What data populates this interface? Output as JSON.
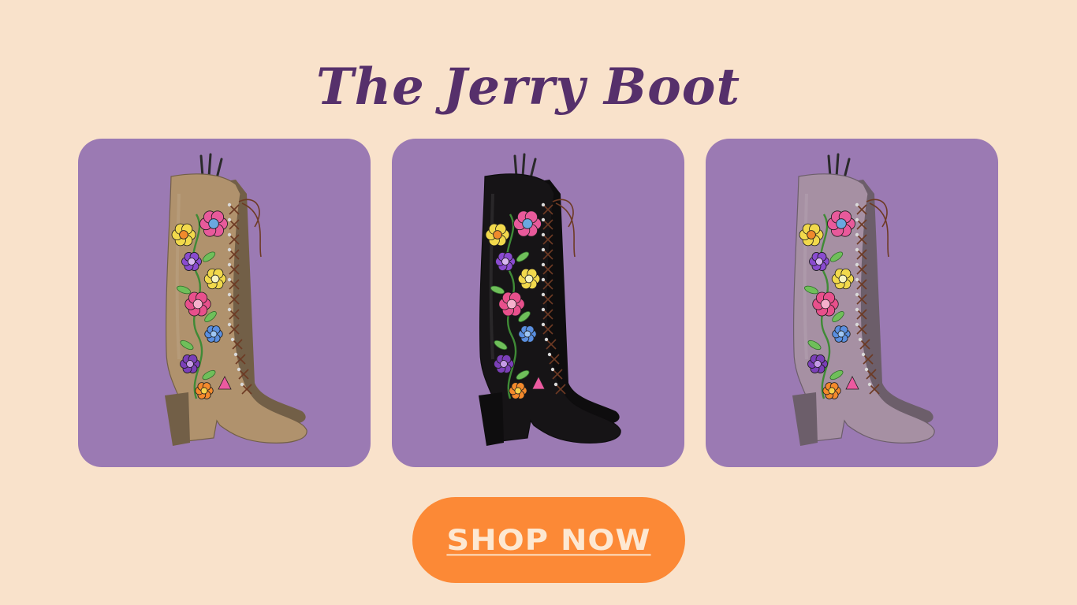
{
  "page": {
    "title": "The Jerry Boot",
    "background_color": "#f9e2cb",
    "title_color": "#56306b",
    "card_color": "#9b7ab3"
  },
  "products": [
    {
      "name": "tan-suede-boot",
      "boot_color": "#b0926d",
      "icon": "embroidered-boot-icon"
    },
    {
      "name": "black-suede-boot",
      "boot_color": "#161416",
      "icon": "embroidered-boot-icon"
    },
    {
      "name": "lavender-suede-boot",
      "boot_color": "#a690a3",
      "icon": "embroidered-boot-icon"
    }
  ],
  "cta": {
    "label": "SHOP NOW",
    "background_color": "#fc8936",
    "text_color": "#fde8d2"
  }
}
